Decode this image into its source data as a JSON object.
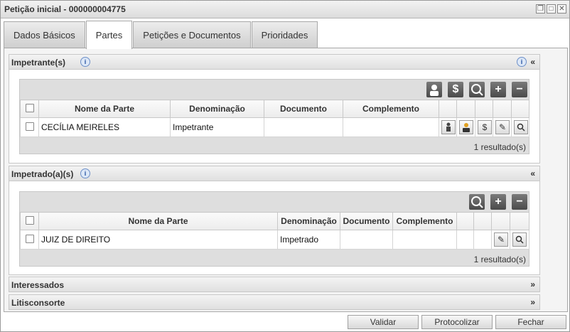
{
  "window": {
    "title": "Petição inicial - 000000004775"
  },
  "tabs": [
    {
      "label": "Dados Básicos",
      "active": false
    },
    {
      "label": "Partes",
      "active": true
    },
    {
      "label": "Petições e Documentos",
      "active": false
    },
    {
      "label": "Prioridades",
      "active": false
    }
  ],
  "sections": {
    "impetrantes": {
      "title": "Impetrante(s)",
      "collapse": "«",
      "columns": [
        "Nome da Parte",
        "Denominação",
        "Documento",
        "Complemento"
      ],
      "rows": [
        {
          "nome": "CECÍLIA MEIRELES",
          "denominacao": "Impetrante",
          "documento": "",
          "complemento": ""
        }
      ],
      "count": "1 resultado(s)"
    },
    "impetrados": {
      "title": "Impetrado(a)(s)",
      "collapse": "«",
      "columns": [
        "Nome da Parte",
        "Denominação",
        "Documento",
        "Complemento"
      ],
      "rows": [
        {
          "nome": "JUIZ DE DIREITO",
          "denominacao": "Impetrado",
          "documento": "",
          "complemento": ""
        }
      ],
      "count": "1 resultado(s)"
    },
    "interessados": {
      "title": "Interessados",
      "expand": "»"
    },
    "litisconsorte": {
      "title": "Litisconsorte",
      "expand": "»"
    }
  },
  "buttons": {
    "validar": "Validar",
    "protocolizar": "Protocolizar",
    "fechar": "Fechar"
  },
  "icons": {
    "info": "i",
    "plus": "+",
    "minus": "−",
    "dollar": "$",
    "search": "⌕",
    "edit": "✎"
  }
}
